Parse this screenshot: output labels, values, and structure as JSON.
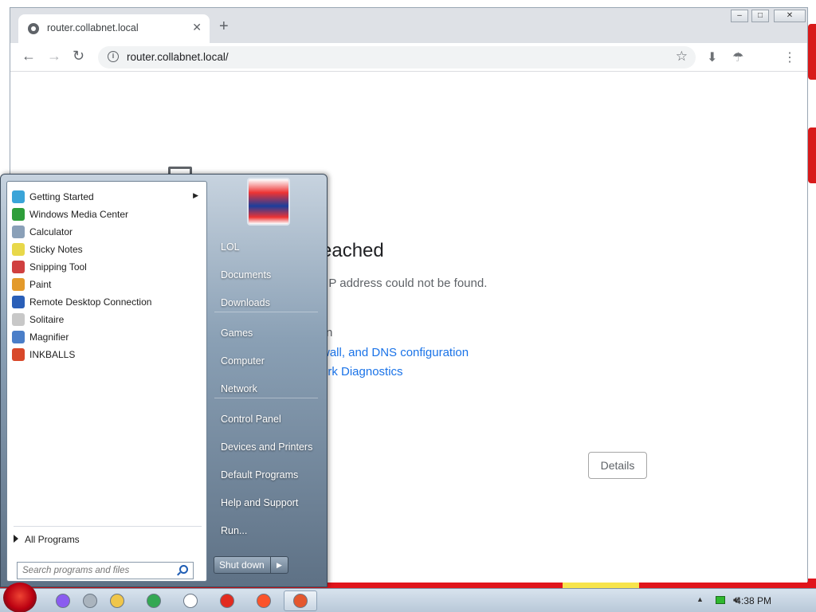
{
  "browser": {
    "tab_title": "router.collabnet.local",
    "address": "router.collabnet.local/"
  },
  "page": {
    "heading": "eached",
    "subtext": "r IP address could not be found.",
    "try_line": "n",
    "link_firewall": "wall, and DNS configuration",
    "link_diagnostics": "ork Diagnostics",
    "details_label": "Details"
  },
  "start_menu": {
    "programs": [
      {
        "label": "Getting Started",
        "icon": "getting-started-icon",
        "color": "#3aa4d8",
        "submenu": true
      },
      {
        "label": "Windows Media Center",
        "icon": "media-center-icon",
        "color": "#2e9e3a"
      },
      {
        "label": "Calculator",
        "icon": "calculator-icon",
        "color": "#8aa0b8"
      },
      {
        "label": "Sticky Notes",
        "icon": "sticky-notes-icon",
        "color": "#e8d84a"
      },
      {
        "label": "Snipping Tool",
        "icon": "snipping-tool-icon",
        "color": "#d04040"
      },
      {
        "label": "Paint",
        "icon": "paint-icon",
        "color": "#e39a2b"
      },
      {
        "label": "Remote Desktop Connection",
        "icon": "remote-desktop-icon",
        "color": "#2a5fb8"
      },
      {
        "label": "Solitaire",
        "icon": "solitaire-icon",
        "color": "#c8c8c8"
      },
      {
        "label": "Magnifier",
        "icon": "magnifier-icon",
        "color": "#4a7ec8"
      },
      {
        "label": "INKBALLS",
        "icon": "inkball-icon",
        "color": "#d8482a"
      }
    ],
    "all_programs": "All Programs",
    "search_placeholder": "Search programs and files",
    "right_items": [
      "LOL",
      "Documents",
      "Downloads",
      "Games",
      "Computer",
      "Network",
      "Control Panel",
      "Devices and Printers",
      "Default Programs",
      "Help and Support",
      "Run..."
    ],
    "shutdown_label": "Shut down"
  },
  "taskbar": {
    "clock": "4:38 PM",
    "apps": [
      {
        "name": "alice-icon",
        "color": "#8a5cf0"
      },
      {
        "name": "apps-grid-icon",
        "color": "#aab4be"
      },
      {
        "name": "folder-icon",
        "color": "#f0c64a"
      },
      {
        "name": "chrome-icon",
        "color": "#34a853"
      },
      {
        "name": "yandex-browser-icon",
        "color": "#ffffff"
      },
      {
        "name": "yandex-icon",
        "color": "#e22b1f"
      },
      {
        "name": "brave-icon",
        "color": "#fb542b"
      },
      {
        "name": "firefox-icon",
        "color": "#e4572e"
      }
    ]
  }
}
